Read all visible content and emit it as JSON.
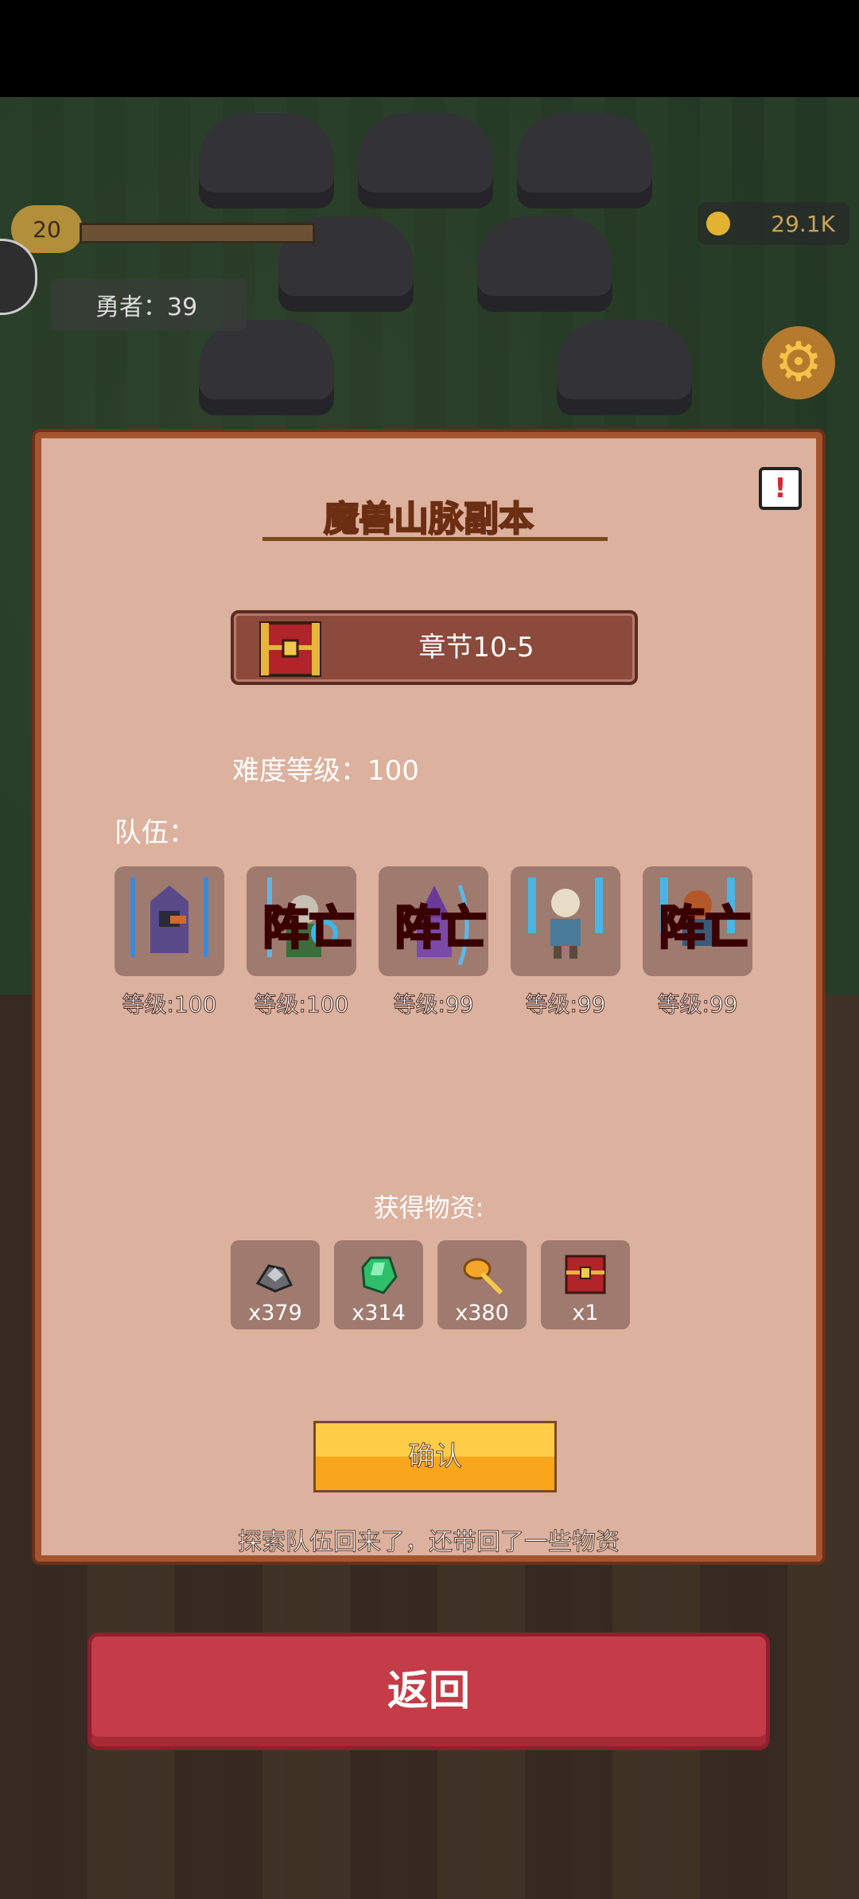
{
  "hud": {
    "player_level": "20",
    "coins": "29.1K",
    "heroes_label": "勇者：39"
  },
  "dialog": {
    "title": "魔兽山脉副本",
    "chapter": "章节10-5",
    "difficulty": "难度等级：100",
    "team_label": "队伍：",
    "dead_label": "阵亡",
    "heroes": [
      {
        "level": "等级:100",
        "dead": false,
        "icon": "hooded-mage-icon"
      },
      {
        "level": "等级:100",
        "dead": true,
        "icon": "staff-sage-icon"
      },
      {
        "level": "等级:99",
        "dead": true,
        "icon": "wizard-archer-icon"
      },
      {
        "level": "等级:99",
        "dead": false,
        "icon": "skeleton-warrior-icon"
      },
      {
        "level": "等级:99",
        "dead": true,
        "icon": "dual-sword-warrior-icon"
      }
    ],
    "loot_label": "获得物资:",
    "loot": [
      {
        "count": "x379",
        "icon": "ore-icon"
      },
      {
        "count": "x314",
        "icon": "emerald-icon"
      },
      {
        "count": "x380",
        "icon": "feather-icon"
      },
      {
        "count": "x1",
        "icon": "treasure-chest-icon"
      }
    ],
    "confirm": "确认",
    "hint": "探索队伍回来了，还带回了一些物资"
  },
  "back": "返回",
  "colors": {
    "panel_bg": "#dcb19e",
    "panel_border": "#a4552f",
    "title": "#f5a82a",
    "dead_text": "#e0162c",
    "confirm": "#f9a61d",
    "back_button": "#c43c47"
  }
}
